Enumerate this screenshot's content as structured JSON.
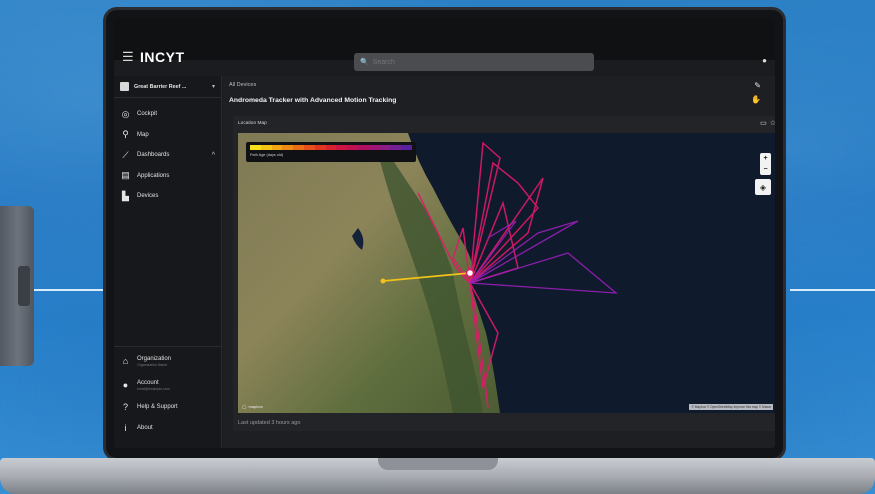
{
  "app": {
    "logo": "INCYT",
    "search_placeholder": "Search"
  },
  "sidebar": {
    "site": "Great Barrier Reef ...",
    "items": [
      {
        "label": "Cockpit",
        "icon": "cockpit-icon"
      },
      {
        "label": "Map",
        "icon": "map-pin-icon"
      },
      {
        "label": "Dashboards",
        "icon": "chart-line-icon"
      },
      {
        "label": "Applications",
        "icon": "grid-icon"
      },
      {
        "label": "Devices",
        "icon": "device-icon"
      }
    ],
    "bottom": [
      {
        "label": "Organization",
        "sub": "Organization Name",
        "icon": "building-icon"
      },
      {
        "label": "Account",
        "sub": "email@example.com",
        "icon": "person-icon"
      },
      {
        "label": "Help & Support",
        "icon": "help-icon"
      },
      {
        "label": "About",
        "icon": "info-icon"
      }
    ]
  },
  "main": {
    "breadcrumb": "All Devices",
    "device_title": "Andromeda Tracker with Advanced Motion Tracking",
    "card_title": "Location Map",
    "legend_label": "Path Age (days old)",
    "last_updated": "Last updated 3 hours ago",
    "mapbox": "mapbox",
    "attribution": "© Mapbox © OpenStreetMap Improve this map © Maxar"
  },
  "colors": {
    "legend": [
      "#f7e11a",
      "#f5c415",
      "#f2a612",
      "#ef8a13",
      "#ec6d16",
      "#e7501b",
      "#e03523",
      "#d8212e",
      "#cc1540",
      "#bf1152",
      "#b00f64",
      "#9e1476",
      "#8b1c86",
      "#741f93",
      "#5a219e"
    ],
    "path_main": "#e0196b",
    "path_purple": "#9a1fb8",
    "path_yellow": "#f2c21a"
  }
}
